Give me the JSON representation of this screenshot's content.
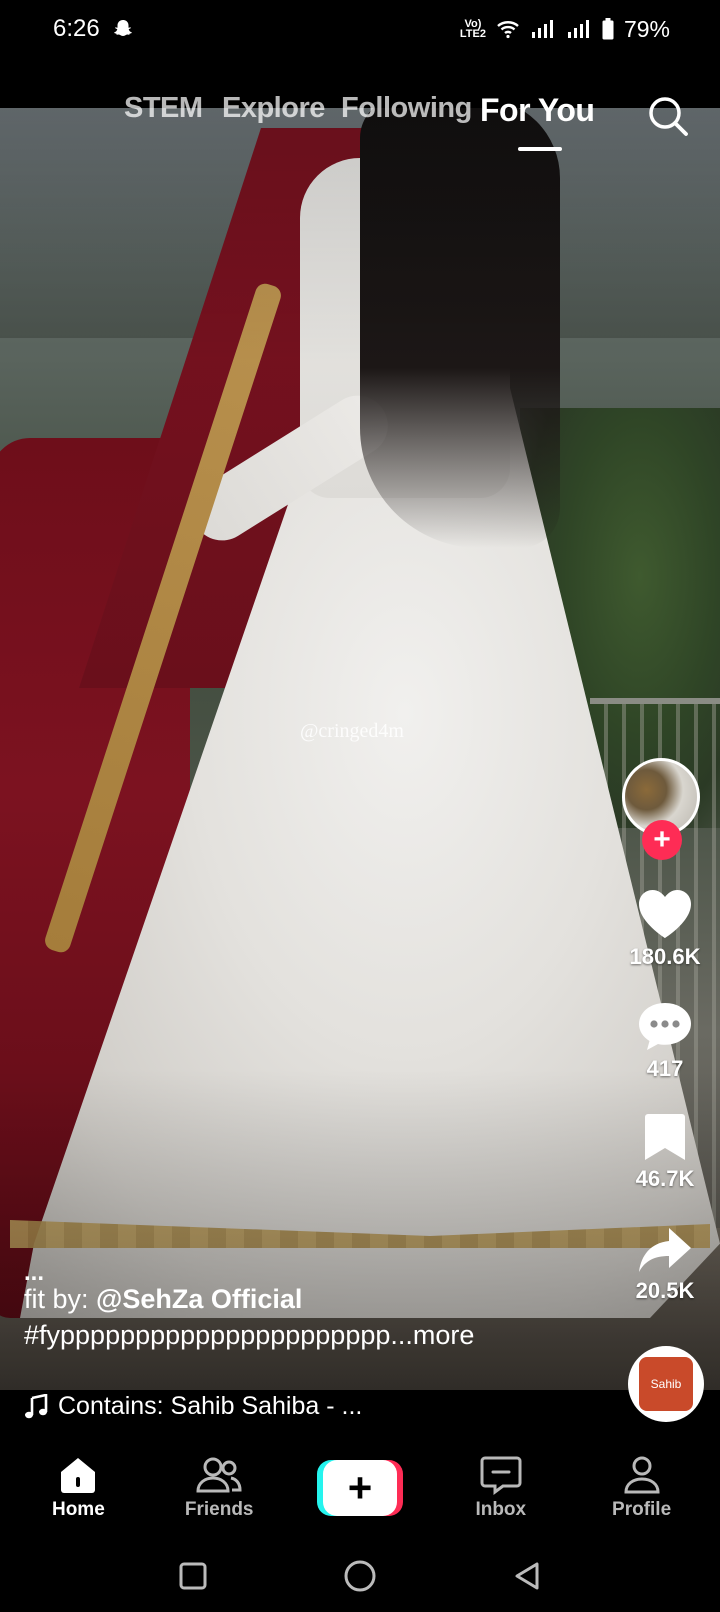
{
  "status_bar": {
    "time": "6:26",
    "battery_percent": "79%",
    "network": "LTE2",
    "icons": [
      "snapchat-icon",
      "volte-icon",
      "wifi-icon",
      "signal-icon",
      "signal-icon",
      "battery-icon"
    ]
  },
  "top_tabs": {
    "items": [
      {
        "label": "STEM"
      },
      {
        "label": "Explore"
      },
      {
        "label": "Following"
      },
      {
        "label": "For You"
      }
    ],
    "active": "For You"
  },
  "video": {
    "watermark": "@cringed4m"
  },
  "right_rail": {
    "likes": "180.6K",
    "comments": "417",
    "saves": "46.7K",
    "shares": "20.5K",
    "follow_symbol": "+",
    "disc_text": "Sahib"
  },
  "caption": {
    "dots": "...",
    "prefix": "fit by: ",
    "user": "@SehZa Official",
    "hashtags": "#fypppppppppppppppppppppp...more"
  },
  "music": {
    "text": "Contains: Sahib Sahiba - ..."
  },
  "bottom_nav": {
    "home": "Home",
    "friends": "Friends",
    "create": "+",
    "inbox": "Inbox",
    "profile": "Profile"
  },
  "colors": {
    "accent": "#fe2c55",
    "cyan": "#25f4ee",
    "inactive": "#b9b9b9"
  }
}
